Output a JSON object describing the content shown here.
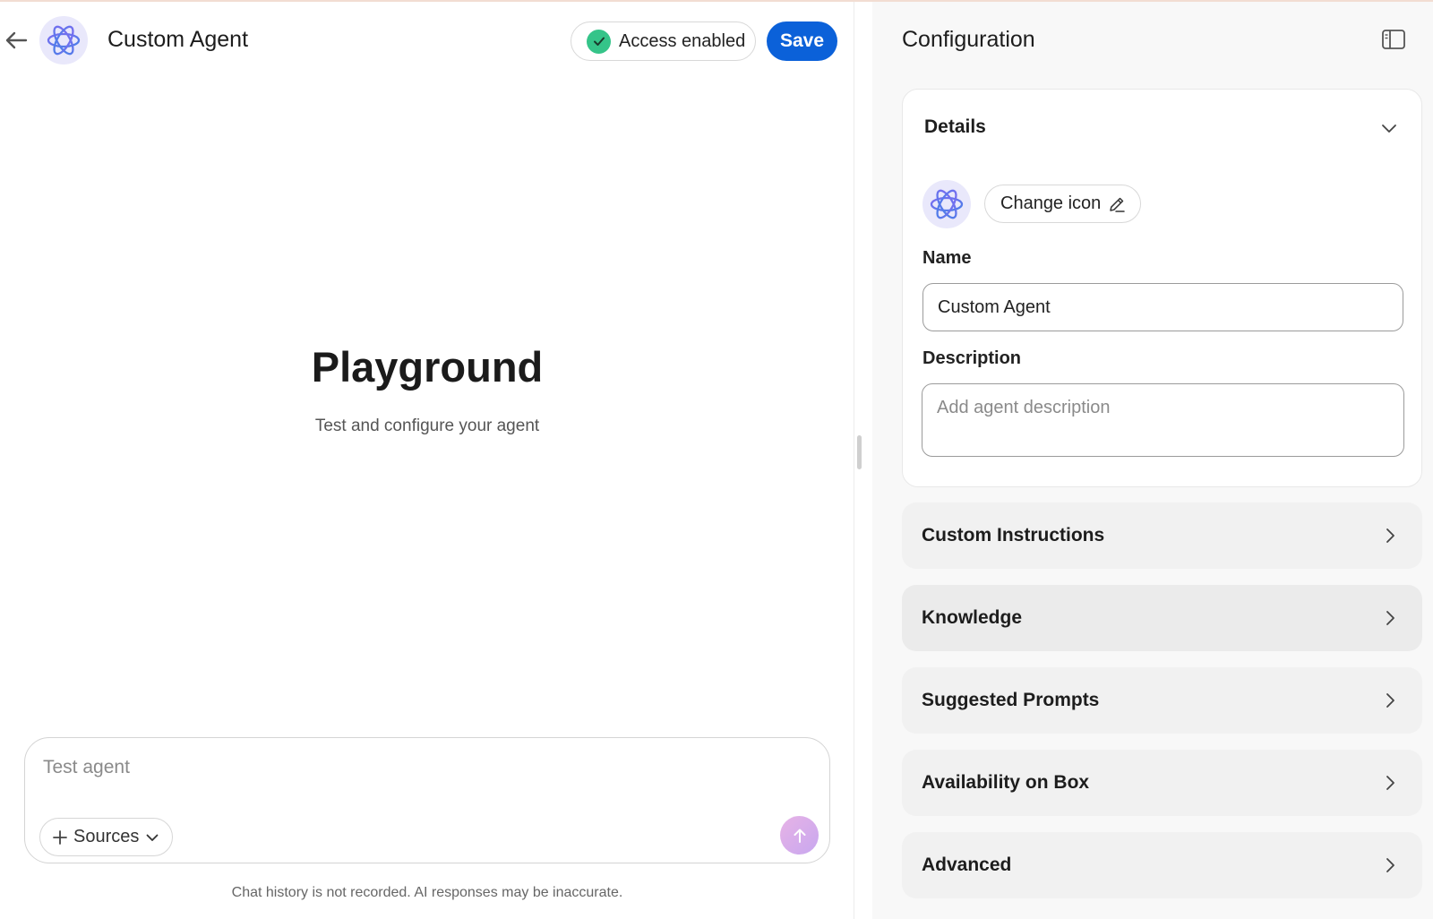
{
  "header": {
    "title": "Custom Agent",
    "access_label": "Access enabled",
    "save_label": "Save"
  },
  "playground": {
    "title": "Playground",
    "subtitle": "Test and configure your agent"
  },
  "chat": {
    "placeholder": "Test agent",
    "sources_label": "Sources",
    "disclaimer": "Chat history is not recorded. AI responses may be inaccurate."
  },
  "config": {
    "title": "Configuration",
    "details": {
      "title": "Details",
      "change_icon_label": "Change icon",
      "name_label": "Name",
      "name_value": "Custom Agent",
      "description_label": "Description",
      "description_placeholder": "Add agent description"
    },
    "sections": [
      {
        "label": "Custom Instructions"
      },
      {
        "label": "Knowledge"
      },
      {
        "label": "Suggested Prompts"
      },
      {
        "label": "Availability on Box"
      },
      {
        "label": "Advanced"
      }
    ]
  },
  "colors": {
    "primary": "#0b61d9",
    "success": "#35c489",
    "icon_accent": "#5b5ce0"
  },
  "icons": {
    "back": "arrow-left-icon",
    "agent": "atom-icon",
    "check": "check-icon",
    "panel_toggle": "sidebar-panel-icon",
    "collapse": "chevron-down-icon",
    "pencil": "pencil-icon",
    "plus": "plus-icon",
    "send": "arrow-up-icon",
    "section_chevron": "chevron-right-icon"
  }
}
